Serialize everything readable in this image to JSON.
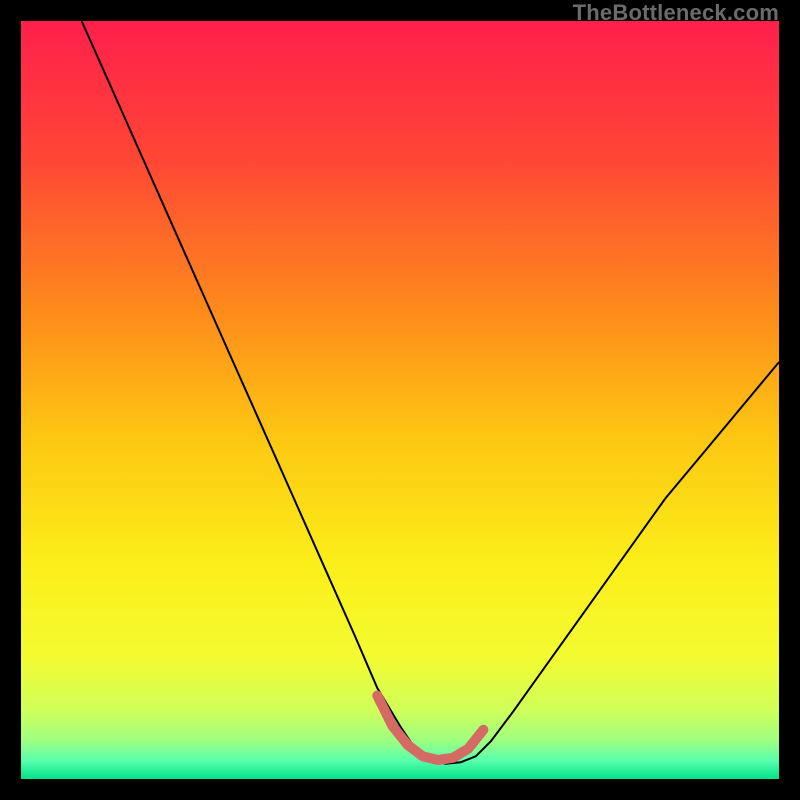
{
  "watermark": "TheBottleneck.com",
  "chart_data": {
    "type": "line",
    "title": "",
    "xlabel": "",
    "ylabel": "",
    "xlim": [
      0,
      100
    ],
    "ylim": [
      0,
      100
    ],
    "grid": false,
    "legend": false,
    "background": {
      "type": "vertical-gradient",
      "stops": [
        {
          "pos": 0.0,
          "color": "#ff1f4c"
        },
        {
          "pos": 0.18,
          "color": "#ff4635"
        },
        {
          "pos": 0.38,
          "color": "#fe8a1c"
        },
        {
          "pos": 0.55,
          "color": "#fdc712"
        },
        {
          "pos": 0.72,
          "color": "#fbef1a"
        },
        {
          "pos": 0.84,
          "color": "#f3fb31"
        },
        {
          "pos": 0.91,
          "color": "#cfff5a"
        },
        {
          "pos": 0.95,
          "color": "#9dff82"
        },
        {
          "pos": 0.975,
          "color": "#5affac"
        },
        {
          "pos": 1.0,
          "color": "#00e38b"
        }
      ]
    },
    "series": [
      {
        "name": "bottleneck-curve",
        "color": "#000000",
        "stroke_width": 2,
        "x": [
          8,
          12,
          16,
          20,
          24,
          28,
          32,
          36,
          40,
          44,
          47,
          50,
          52,
          54,
          56,
          58,
          60,
          62,
          65,
          70,
          75,
          80,
          85,
          90,
          95,
          100
        ],
        "y": [
          100,
          91,
          82,
          73,
          64,
          55,
          46,
          37,
          28,
          19,
          12,
          7,
          4,
          2.5,
          2,
          2.2,
          3,
          5,
          9,
          16,
          23,
          30,
          37,
          43,
          49,
          55
        ]
      }
    ],
    "highlight": {
      "name": "optimal-range",
      "color": "#d46a63",
      "stroke_width": 10,
      "x": [
        47,
        49,
        51,
        53,
        55,
        57,
        59,
        61
      ],
      "y": [
        11,
        7,
        4.5,
        3,
        2.5,
        2.8,
        4,
        6.5
      ]
    }
  }
}
